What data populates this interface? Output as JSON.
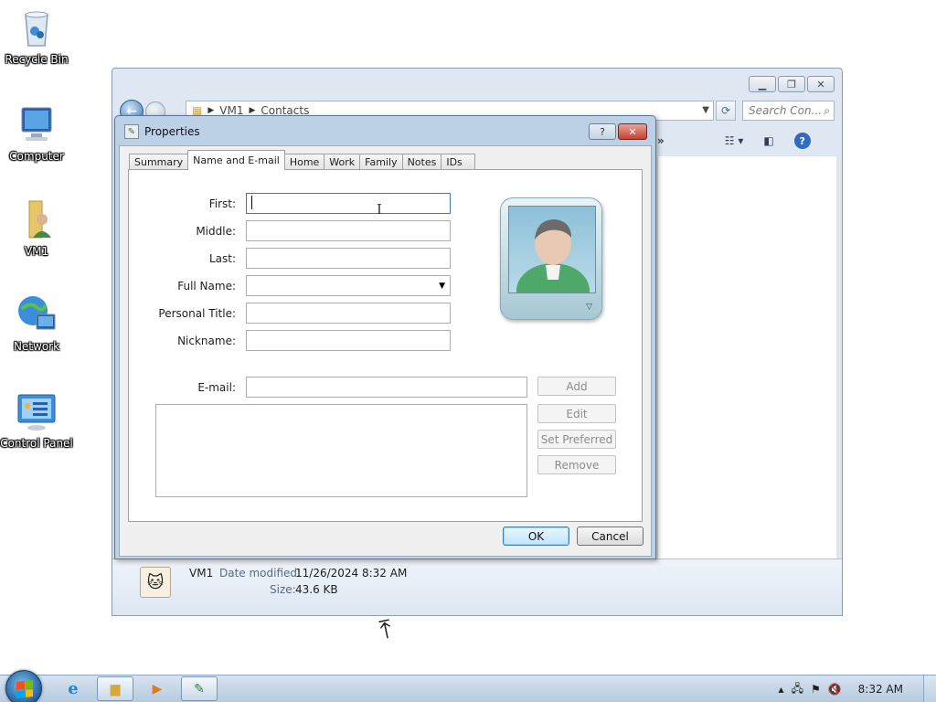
{
  "desktop": {
    "icons": [
      {
        "label": "Recycle Bin",
        "icon": "recycle-bin-icon"
      },
      {
        "label": "Computer",
        "icon": "computer-icon"
      },
      {
        "label": "VM1",
        "icon": "user-folder-icon"
      },
      {
        "label": "Network",
        "icon": "network-icon"
      },
      {
        "label": "Control Panel",
        "icon": "control-panel-icon"
      }
    ]
  },
  "explorer": {
    "address": {
      "root": "VM1",
      "current": "Contacts"
    },
    "search_placeholder": "Search Con...",
    "toolbar_overflow": "»",
    "details": {
      "name": "VM1",
      "date_label": "Date modified:",
      "date_value": "11/26/2024 8:32 AM",
      "size_label": "Size:",
      "size_value": "43.6 KB"
    }
  },
  "dialog": {
    "title": "Properties",
    "help_label": "?",
    "close_label": "✕",
    "tabs": [
      {
        "label": "Summary"
      },
      {
        "label": "Name and E-mail",
        "active": true
      },
      {
        "label": "Home"
      },
      {
        "label": "Work"
      },
      {
        "label": "Family"
      },
      {
        "label": "Notes"
      },
      {
        "label": "IDs"
      }
    ],
    "fields": {
      "first": {
        "label": "First:",
        "value": ""
      },
      "middle": {
        "label": "Middle:",
        "value": ""
      },
      "last": {
        "label": "Last:",
        "value": ""
      },
      "full_name": {
        "label": "Full Name:",
        "value": ""
      },
      "personal_title": {
        "label": "Personal Title:",
        "value": ""
      },
      "nickname": {
        "label": "Nickname:",
        "value": ""
      },
      "email": {
        "label": "E-mail:",
        "value": ""
      }
    },
    "email_buttons": {
      "add": "Add",
      "edit": "Edit",
      "set_preferred": "Set Preferred",
      "remove": "Remove"
    },
    "ok_label": "OK",
    "cancel_label": "Cancel"
  },
  "taskbar": {
    "clock": "8:32 AM",
    "pinned": [
      {
        "icon": "internet-explorer-icon"
      },
      {
        "icon": "explorer-folder-icon"
      },
      {
        "icon": "media-player-icon"
      },
      {
        "icon": "contacts-window-icon"
      }
    ]
  }
}
